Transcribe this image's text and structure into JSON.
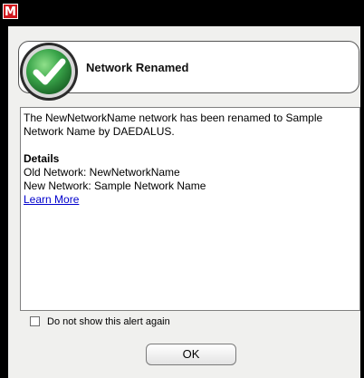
{
  "window": {
    "app_icon": "M",
    "accent_color": "#d0161d"
  },
  "header": {
    "title": "Network Renamed",
    "icon": "checkmark-success-icon",
    "icon_color": "#3aa54a"
  },
  "message": {
    "body": "The NewNetworkName network has been renamed to Sample Network Name by DAEDALUS.",
    "details_heading": "Details",
    "old_network": "Old Network: NewNetworkName",
    "new_network": "New Network: Sample Network Name",
    "learn_more": "Learn More"
  },
  "options": {
    "dont_show_label": "Do not show this alert again",
    "dont_show_checked": false
  },
  "buttons": {
    "ok_label": "OK"
  }
}
